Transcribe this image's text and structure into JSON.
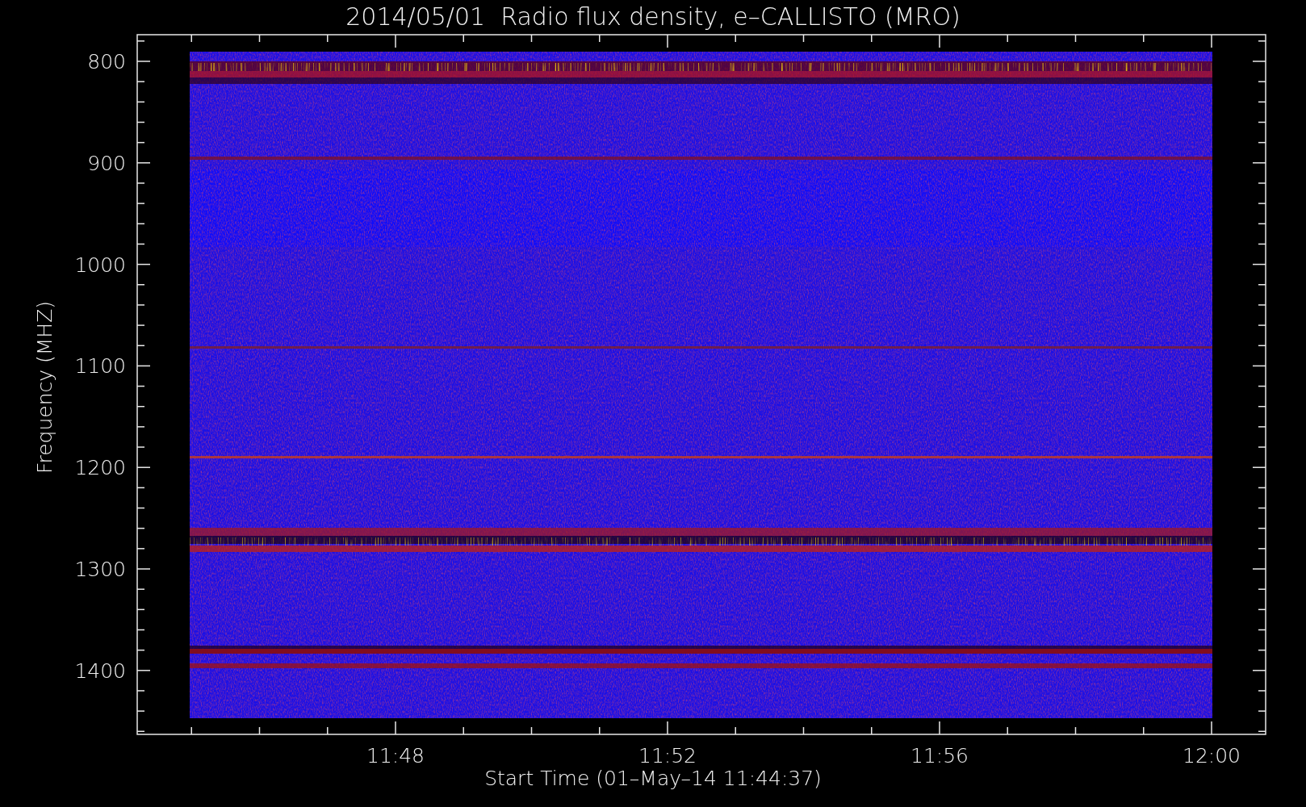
{
  "title": "2014/05/01  Radio flux density, e–CALLISTO (MRO)",
  "y_axis": {
    "label": "Frequency (MHZ)",
    "ticks": [
      "800",
      "900",
      "1000",
      "1100",
      "1200",
      "1300",
      "1400"
    ]
  },
  "x_axis": {
    "label": "Start Time (01–May–14 11:44:37)",
    "ticks": [
      "11:48",
      "11:52",
      "11:56",
      "12:00"
    ]
  }
}
